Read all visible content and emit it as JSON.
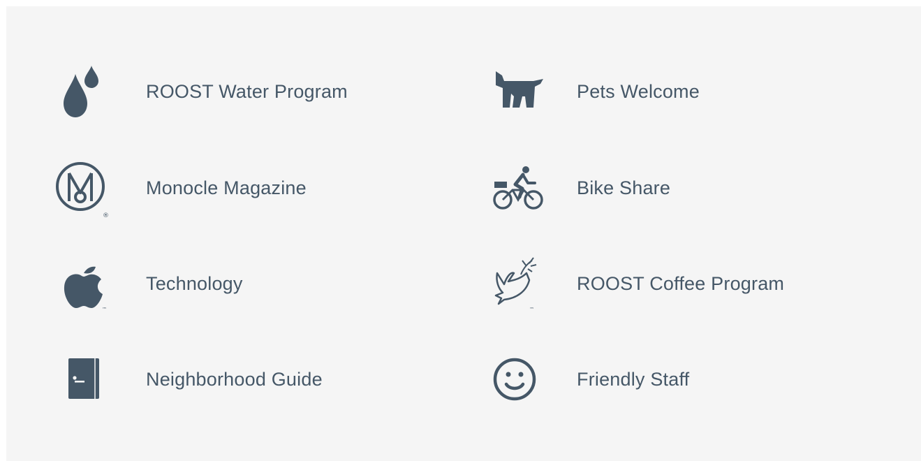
{
  "amenities": {
    "left": [
      {
        "label": "ROOST Water Program",
        "icon": "water-drops-icon"
      },
      {
        "label": "Monocle Magazine",
        "icon": "monocle-logo-icon",
        "mark": "®"
      },
      {
        "label": "Technology",
        "icon": "apple-logo-icon",
        "mark": "™"
      },
      {
        "label": "Neighborhood Guide",
        "icon": "guide-book-icon"
      }
    ],
    "right": [
      {
        "label": "Pets Welcome",
        "icon": "dog-icon"
      },
      {
        "label": "Bike Share",
        "icon": "bicycle-icon"
      },
      {
        "label": "ROOST Coffee Program",
        "icon": "dove-logo-icon",
        "mark": "™"
      },
      {
        "label": "Friendly Staff",
        "icon": "smiley-face-icon"
      }
    ]
  },
  "colors": {
    "icon": "#455767",
    "text": "#455767",
    "background": "#f5f5f5"
  }
}
